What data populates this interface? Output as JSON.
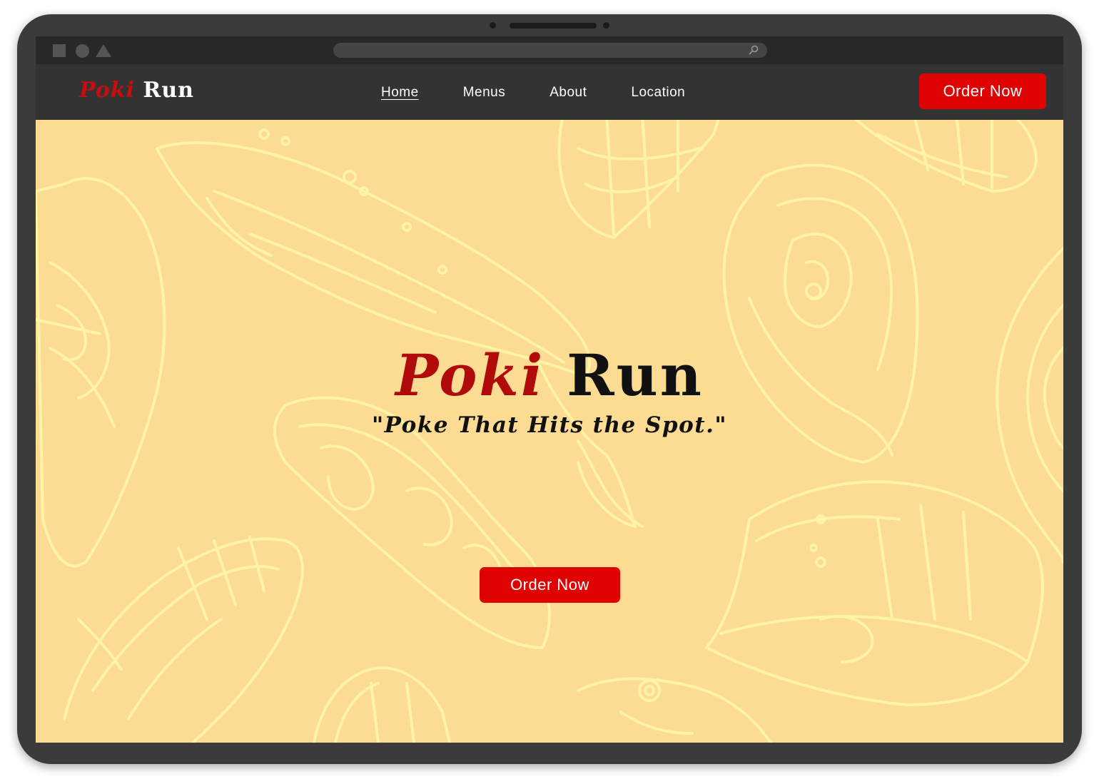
{
  "nav": {
    "logo_part1": "Poki",
    "logo_part2": "Run",
    "links": [
      {
        "label": "Home",
        "active": true
      },
      {
        "label": "Menus",
        "active": false
      },
      {
        "label": "About",
        "active": false
      },
      {
        "label": "Location",
        "active": false
      }
    ],
    "order_button": "Order Now"
  },
  "hero": {
    "title_part1": "Poki",
    "title_part2": "Run",
    "tagline": "\"Poke That Hits the Spot.\"",
    "order_button": "Order Now"
  },
  "colors": {
    "accent_red": "#e00303",
    "logo_red": "#c70d0d",
    "navbar": "#333333",
    "hero_bg": "#fcdb92",
    "illustration_line": "#fff3a6"
  },
  "icons": {
    "url_search": "search-icon"
  }
}
